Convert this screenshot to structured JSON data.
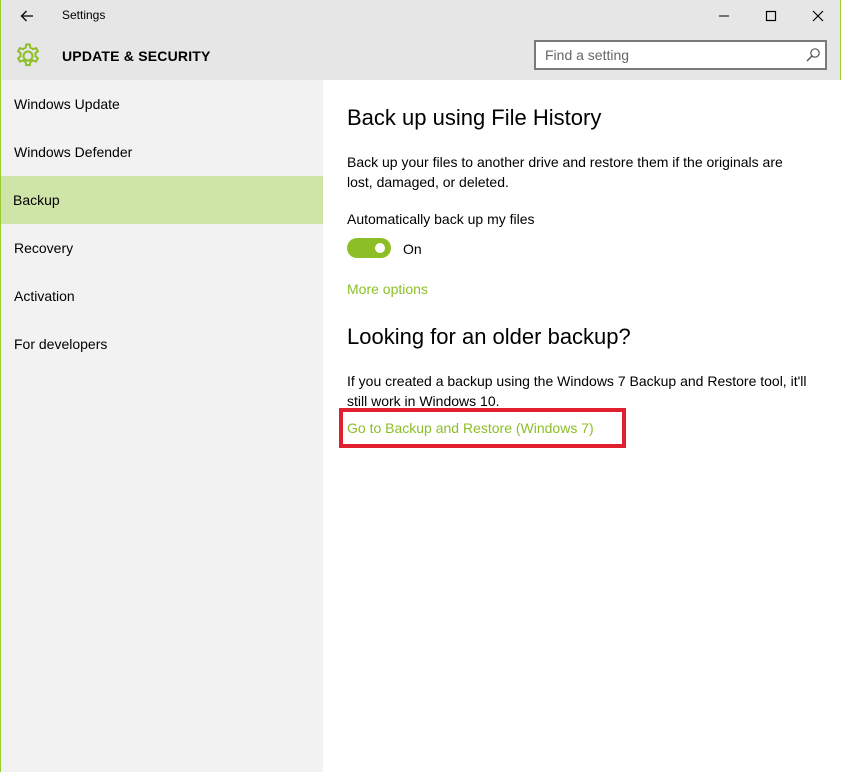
{
  "window": {
    "title": "Settings"
  },
  "header": {
    "section_title": "UPDATE & SECURITY",
    "search_placeholder": "Find a setting"
  },
  "sidebar": {
    "items": [
      {
        "label": "Windows Update",
        "active": false
      },
      {
        "label": "Windows Defender",
        "active": false
      },
      {
        "label": "Backup",
        "active": true
      },
      {
        "label": "Recovery",
        "active": false
      },
      {
        "label": "Activation",
        "active": false
      },
      {
        "label": "For developers",
        "active": false
      }
    ]
  },
  "content": {
    "file_history": {
      "heading": "Back up using File History",
      "description": "Back up your files to another drive and restore them if the originals are lost, damaged, or deleted.",
      "auto_backup_label": "Automatically back up my files",
      "toggle_state": "On",
      "more_options": "More options"
    },
    "older_backup": {
      "heading": "Looking for an older backup?",
      "description": "If you created a backup using the Windows 7 Backup and Restore tool, it'll still work in Windows 10.",
      "link": "Go to Backup and Restore (Windows 7)"
    }
  },
  "colors": {
    "accent": "#8cbf26",
    "active_nav": "#cfe4a7",
    "highlight": "#e0202e",
    "chrome": "#e6e6e6",
    "sidebar_bg": "#f2f2f2"
  },
  "icons": {
    "back": "back-arrow-icon",
    "gear": "gear-icon",
    "search": "search-icon",
    "minimize": "minimize-icon",
    "maximize": "maximize-icon",
    "close": "close-icon"
  }
}
